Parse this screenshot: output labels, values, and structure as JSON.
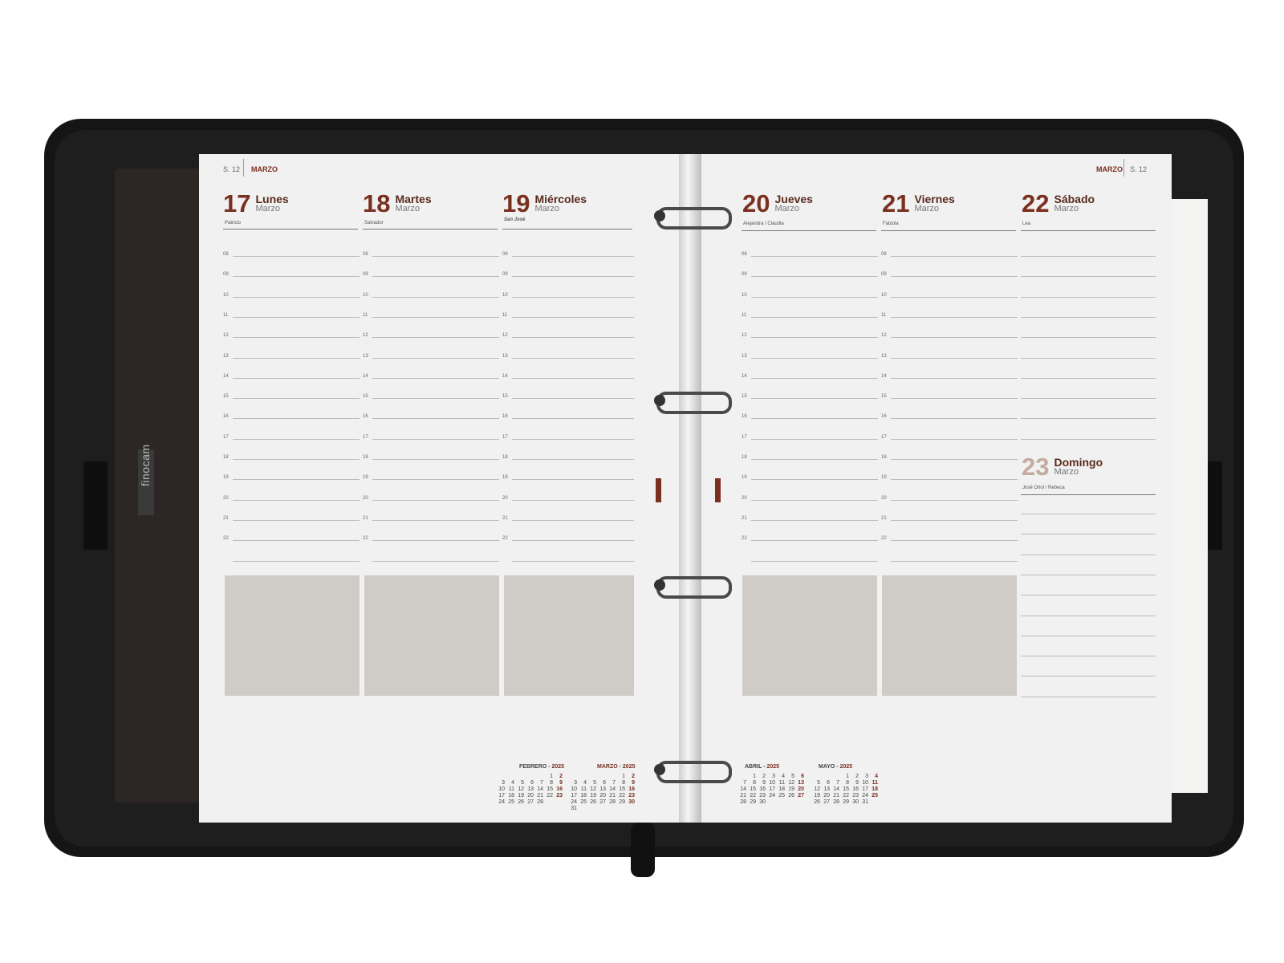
{
  "left_page": {
    "week": "S. 12",
    "month": "MARZO",
    "days": [
      {
        "num": "17",
        "name": "Lunes",
        "month": "Marzo",
        "saint": "Patricio"
      },
      {
        "num": "18",
        "name": "Martes",
        "month": "Marzo",
        "saint": "Salvador"
      },
      {
        "num": "19",
        "name": "Miércoles",
        "month": "Marzo",
        "saint": "San José"
      }
    ],
    "calendars": [
      {
        "month": "FEBRERO",
        "year": "2025"
      },
      {
        "month": "MARZO",
        "year": "2025"
      }
    ]
  },
  "right_page": {
    "week": "S. 12",
    "month": "MARZO",
    "days": [
      {
        "num": "20",
        "name": "Jueves",
        "month": "Marzo",
        "saint": "Alejandra / Claudia"
      },
      {
        "num": "21",
        "name": "Viernes",
        "month": "Marzo",
        "saint": "Fabiola"
      },
      {
        "num": "22",
        "name": "Sábado",
        "month": "Marzo",
        "saint": "Lea"
      },
      {
        "num": "23",
        "name": "Domingo",
        "month": "Marzo",
        "saint": "José Oriol / Rebeca"
      }
    ],
    "calendars": [
      {
        "month": "ABRIL",
        "year": "2025"
      },
      {
        "month": "MAYO",
        "year": "2025"
      }
    ]
  },
  "hours": [
    "08",
    "09",
    "10",
    "11",
    "12",
    "13",
    "14",
    "15",
    "16",
    "17",
    "18",
    "19",
    "20",
    "21",
    "22"
  ],
  "brand": "finocam",
  "mini_cal": {
    "feb": [
      "",
      "",
      "",
      "",
      "",
      "1",
      "2",
      "3",
      "4",
      "5",
      "6",
      "7",
      "8",
      "9",
      "10",
      "11",
      "12",
      "13",
      "14",
      "15",
      "16",
      "17",
      "18",
      "19",
      "20",
      "21",
      "22",
      "23",
      "24",
      "25",
      "26",
      "27",
      "28",
      "",
      ""
    ],
    "mar": [
      "",
      "",
      "",
      "",
      "",
      "1",
      "2",
      "3",
      "4",
      "5",
      "6",
      "7",
      "8",
      "9",
      "10",
      "11",
      "12",
      "13",
      "14",
      "15",
      "16",
      "17",
      "18",
      "19",
      "20",
      "21",
      "22",
      "23",
      "24",
      "25",
      "26",
      "27",
      "28",
      "29",
      "30",
      "31"
    ],
    "apr": [
      "",
      "1",
      "2",
      "3",
      "4",
      "5",
      "6",
      "7",
      "8",
      "9",
      "10",
      "11",
      "12",
      "13",
      "14",
      "15",
      "16",
      "17",
      "18",
      "19",
      "20",
      "21",
      "22",
      "23",
      "24",
      "25",
      "26",
      "27",
      "28",
      "29",
      "30"
    ],
    "may": [
      "",
      "",
      "",
      "1",
      "2",
      "3",
      "4",
      "5",
      "6",
      "7",
      "8",
      "9",
      "10",
      "11",
      "12",
      "13",
      "14",
      "15",
      "16",
      "17",
      "18",
      "19",
      "20",
      "21",
      "22",
      "23",
      "24",
      "25",
      "26",
      "27",
      "28",
      "29",
      "30",
      "31"
    ]
  },
  "colors": {
    "accent": "#7a3020",
    "page": "#f0f1f0",
    "cover": "#151515",
    "box": "#cfccc8"
  }
}
